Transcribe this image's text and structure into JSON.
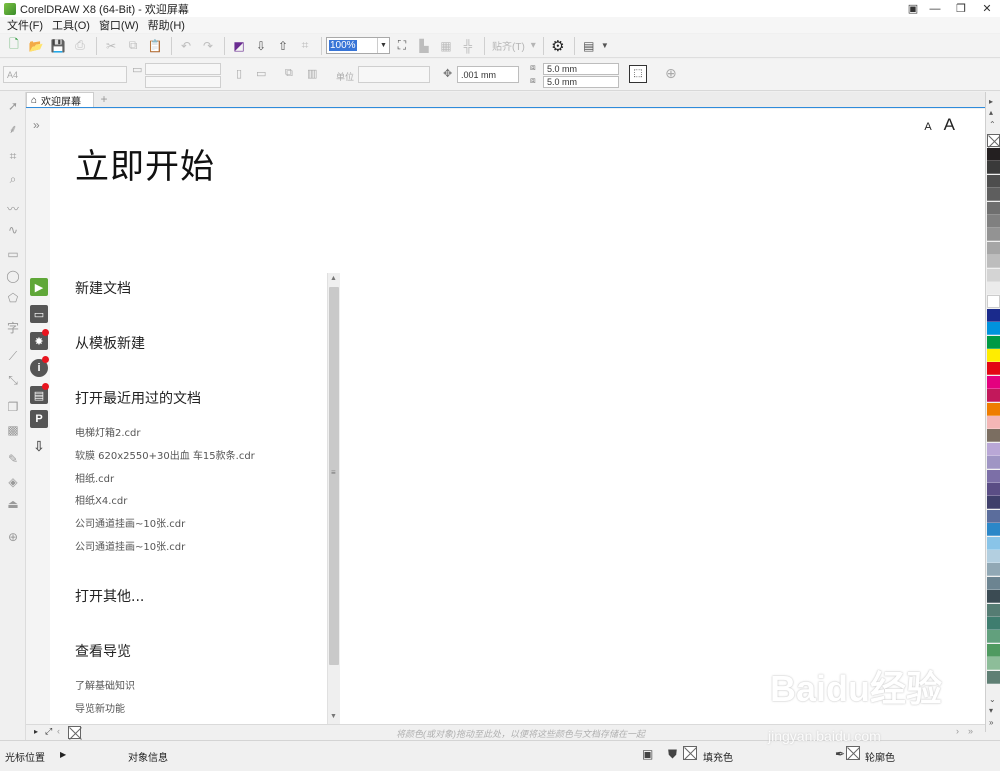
{
  "window": {
    "title": "CorelDRAW X8 (64-Bit) - 欢迎屏幕",
    "minimize_glyph": "—",
    "restore_glyph": "❐",
    "close_glyph": "✕"
  },
  "menu": [
    "文件(F)",
    "工具(O)",
    "窗口(W)",
    "帮助(H)"
  ],
  "toolbar": {
    "zoom_value": "100%",
    "snap_label": "贴齐(T)",
    "icons": [
      "new-document",
      "open",
      "save",
      "import",
      "export",
      "undo",
      "redo",
      "launcher",
      "settings",
      "view-options"
    ]
  },
  "property_bar": {
    "page_size": "A4",
    "units_label": "单位",
    "nudge": ".001 mm",
    "dup_x": "5.0 mm",
    "dup_y": "5.0 mm"
  },
  "doc_tabs": [
    {
      "label": "欢迎屏幕"
    }
  ],
  "welcome": {
    "title": "立即开始",
    "font_small": "A",
    "font_large": "A",
    "nav": {
      "new_doc": "新建文档",
      "from_template": "从模板新建",
      "recent_heading": "打开最近用过的文档",
      "recent_files": [
        "电梯灯箱2.cdr",
        "软膜 620x2550+30出血 车15款条.cdr",
        "相纸.cdr",
        "相纸X4.cdr",
        "公司通道挂画~10张.cdr",
        "公司通道挂画~10张.cdr"
      ],
      "open_other": "打开其他...",
      "tour_heading": "查看导览",
      "tour_items": [
        "了解基础知识",
        "导览新功能"
      ]
    }
  },
  "docbar_hint": "将颜色(或对象)拖动至此处，以便将这些颜色与文档存储在一起",
  "status": {
    "cursor_position": "光标位置",
    "object_info": "对象信息",
    "fill_label": "填充色",
    "outline_label": "轮廓色"
  },
  "palette_colors": [
    "#231f20",
    "#3a3a3a",
    "#4d4d4d",
    "#5e5e5e",
    "#6f6f6f",
    "#808080",
    "#939393",
    "#a6a6a6",
    "#bdbdbd",
    "#d4d4d4",
    "#ebebeb",
    "#ffffff",
    "#1a2a8c",
    "#0093dd",
    "#009a44",
    "#ffed00",
    "#e30613",
    "#e4007f",
    "#c2185b",
    "#ef7d00",
    "#f4b6b6",
    "#7b6e61",
    "#b9a7d6",
    "#9f95c4",
    "#7c6fa7",
    "#5a4d85",
    "#3f3f6b",
    "#5b6d9c",
    "#2b87c8",
    "#89c4e8",
    "#b3cfe0",
    "#91a8b5",
    "#6c8491",
    "#3b4b53",
    "#557c73",
    "#3f7d6f",
    "#62a07d",
    "#4f9a60",
    "#8dbd99",
    "#5f7f74"
  ],
  "watermark": {
    "main": "Baidu经验",
    "sub": "jingyan.baidu.com"
  }
}
